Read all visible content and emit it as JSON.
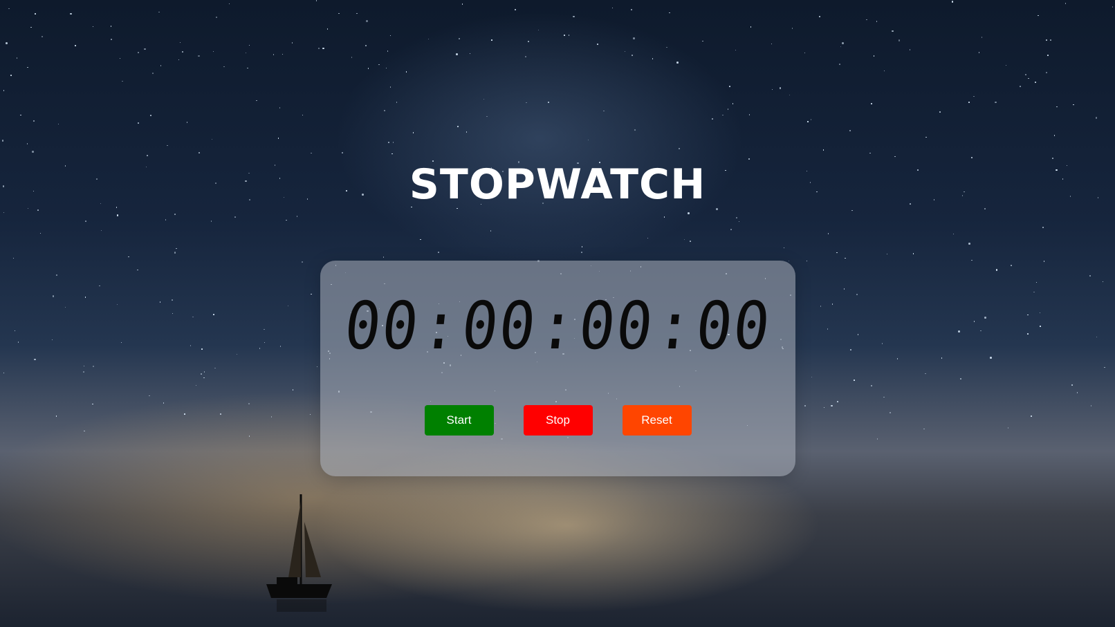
{
  "page": {
    "title": "STOPWATCH"
  },
  "display": {
    "hours": "00",
    "minutes": "00",
    "seconds": "00",
    "milliseconds": "00",
    "separator": ":"
  },
  "buttons": {
    "start": {
      "label": "Start",
      "color": "#008000"
    },
    "stop": {
      "label": "Stop",
      "color": "#ff0000"
    },
    "reset": {
      "label": "Reset",
      "color": "#ff4500"
    }
  }
}
